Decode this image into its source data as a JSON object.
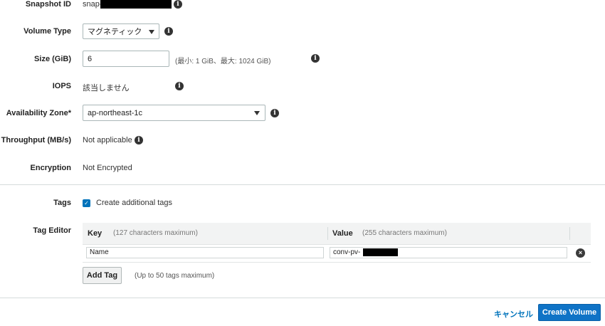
{
  "form": {
    "snapshot": {
      "label": "Snapshot ID",
      "value": "snap-"
    },
    "volume_type": {
      "label": "Volume Type",
      "value": "マグネティック"
    },
    "size": {
      "label": "Size (GiB)",
      "value": "6",
      "hint": "(最小: 1 GiB、最大: 1024 GiB)"
    },
    "iops": {
      "label": "IOPS",
      "value": "該当しません"
    },
    "az": {
      "label": "Availability Zone*",
      "value": "ap-northeast-1c"
    },
    "throughput": {
      "label": "Throughput (MB/s)",
      "value": "Not applicable"
    },
    "encryption": {
      "label": "Encryption",
      "value": "Not Encrypted"
    }
  },
  "tags": {
    "label": "Tags",
    "checkbox_label": "Create additional tags",
    "checked": true
  },
  "tag_editor": {
    "label": "Tag Editor",
    "key_header": "Key",
    "key_hint": "(127 characters maximum)",
    "value_header": "Value",
    "value_hint": "(255 characters maximum)",
    "rows": [
      {
        "key": "Name",
        "value": "conv-pv-"
      }
    ],
    "add_tag_label": "Add Tag",
    "add_tag_hint": "(Up to 50 tags maximum)"
  },
  "footer": {
    "cancel_label": "キャンセル",
    "create_label": "Create Volume"
  },
  "icons": {
    "info": "info-icon",
    "dropdown": "chevron-down-icon",
    "remove": "close-circle-icon",
    "check": "checkmark-icon"
  },
  "colors": {
    "accent": "#0073bb",
    "primary_button": "#0f73c6",
    "redaction": "#000000"
  }
}
